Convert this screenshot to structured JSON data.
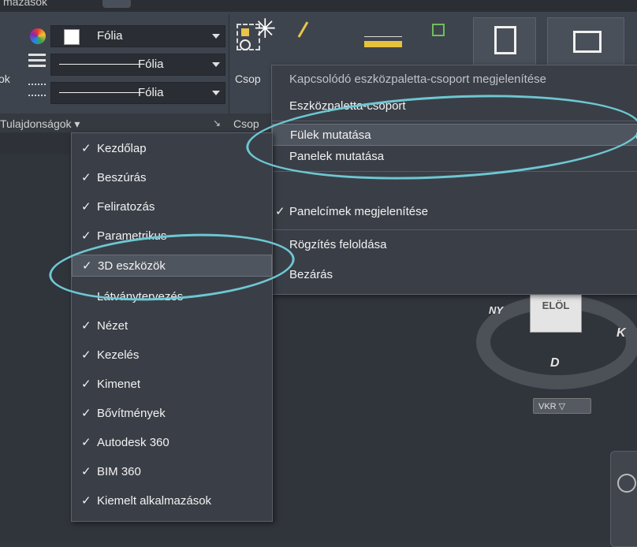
{
  "ribbon": {
    "top_tab_label": "mazások",
    "panel_left_edge_label": "ok",
    "props": {
      "color_value": "Fólia",
      "linetype_value": "Fólia",
      "lineweight_value": "Fólia"
    },
    "group_button_label": "Csop",
    "group_panel_label": "Csop",
    "properties_panel_label": "Tulajdonságok ▾",
    "properties_panel_expander": "↘"
  },
  "context_menu": {
    "header": "Kapcsolódó eszközpaletta-csoport megjelenítése",
    "items": [
      {
        "label": "Eszközpaletta-csoport",
        "submenu": true
      },
      {
        "label": "Fülek mutatása",
        "submenu": true,
        "highlighted": true
      },
      {
        "label": "Panelek mutatása",
        "submenu": true
      },
      {
        "label": "Panelcímek megjelenítése",
        "checked": true
      },
      {
        "label": "Rögzítés feloldása"
      },
      {
        "label": "Bezárás"
      }
    ]
  },
  "tabs_submenu": {
    "items": [
      {
        "label": "Kezdőlap",
        "checked": true
      },
      {
        "label": "Beszúrás",
        "checked": true
      },
      {
        "label": "Feliratozás",
        "checked": true
      },
      {
        "label": "Parametrikus",
        "checked": true
      },
      {
        "label": "3D eszközök",
        "checked": true,
        "highlighted": true
      },
      {
        "label": "Látványtervezés",
        "checked": false
      },
      {
        "label": "Nézet",
        "checked": true
      },
      {
        "label": "Kezelés",
        "checked": true
      },
      {
        "label": "Kimenet",
        "checked": true
      },
      {
        "label": "Bővítmények",
        "checked": true
      },
      {
        "label": "Autodesk 360",
        "checked": true
      },
      {
        "label": "BIM 360",
        "checked": true
      },
      {
        "label": "Kiemelt alkalmazások",
        "checked": true
      }
    ],
    "check_glyph": "✓"
  },
  "viewcube": {
    "face": "ELÖL",
    "east": "K",
    "south": "D",
    "west": "NY",
    "ucs_menu": "VKR ▽"
  },
  "colors": {
    "annotation": "#6ec7d3",
    "menu_bg": "#3a3f47",
    "highlight": "#4f555e"
  }
}
